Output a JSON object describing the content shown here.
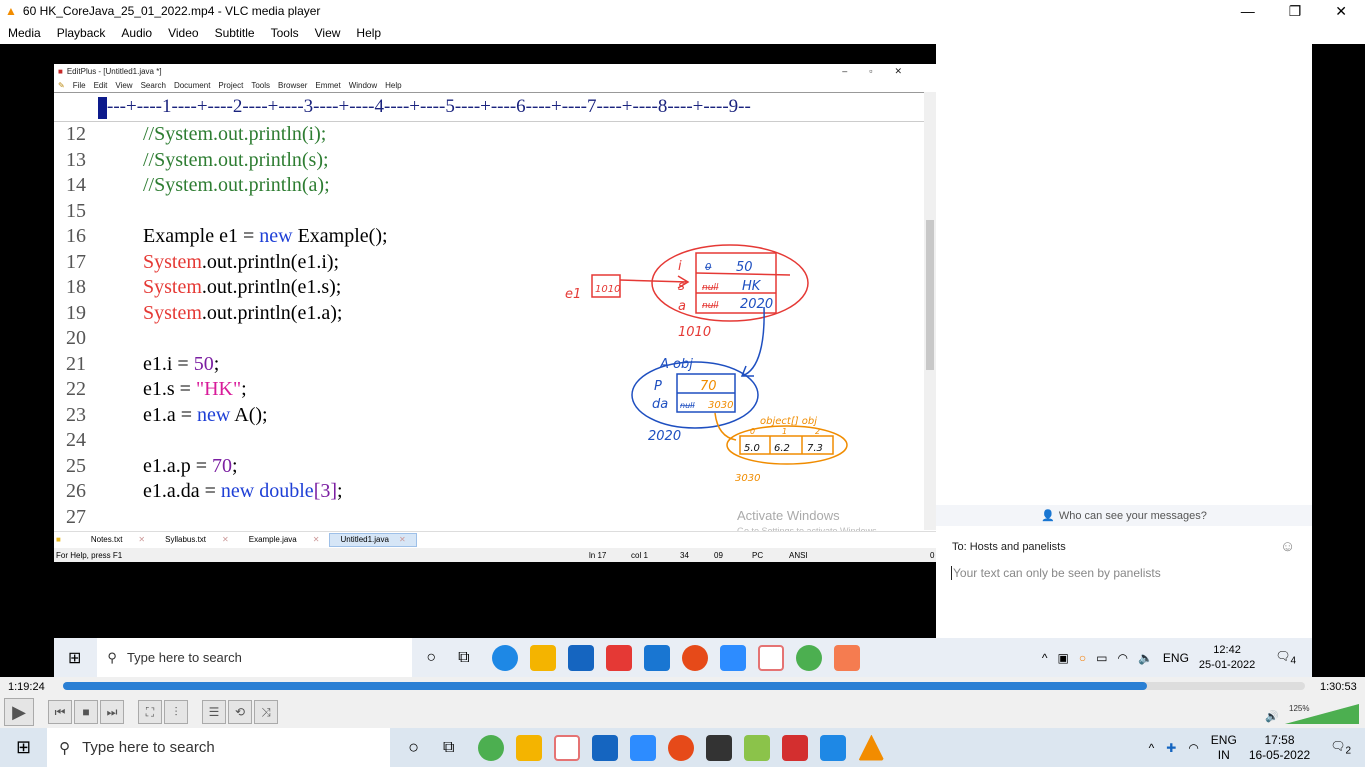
{
  "vlc": {
    "title": "60 HK_CoreJava_25_01_2022.mp4 - VLC media player",
    "menu": [
      "Media",
      "Playback",
      "Audio",
      "Video",
      "Subtitle",
      "Tools",
      "View",
      "Help"
    ],
    "time_elapsed": "1:19:24",
    "time_total": "1:30:53",
    "progress": 0.873,
    "volume": "125%"
  },
  "editplus": {
    "title": "EditPlus - [Untitled1.java *]",
    "menu": [
      "File",
      "Edit",
      "View",
      "Search",
      "Document",
      "Project",
      "Tools",
      "Browser",
      "Emmet",
      "Window",
      "Help"
    ],
    "ruler": "---+----1----+----2----+----3----+----4----+----5----+----6----+----7----+----8----+----9--",
    "lines": [
      {
        "n": "12",
        "parts": [
          [
            "cmt",
            "//System.out.println(i);"
          ]
        ]
      },
      {
        "n": "13",
        "parts": [
          [
            "cmt",
            "//System.out.println(s);"
          ]
        ]
      },
      {
        "n": "14",
        "parts": [
          [
            "cmt",
            "//System.out.println(a);"
          ]
        ]
      },
      {
        "n": "15",
        "parts": []
      },
      {
        "n": "16",
        "parts": [
          [
            "",
            "Example e1 = "
          ],
          [
            "kw",
            "new"
          ],
          [
            "",
            " Example();"
          ]
        ]
      },
      {
        "n": "17",
        "parts": [
          [
            "red",
            "System"
          ],
          [
            "",
            ".out.println(e1.i);"
          ]
        ]
      },
      {
        "n": "18",
        "parts": [
          [
            "red",
            "System"
          ],
          [
            "",
            ".out.println(e1.s);"
          ]
        ]
      },
      {
        "n": "19",
        "parts": [
          [
            "red",
            "System"
          ],
          [
            "",
            ".out.println(e1.a);"
          ]
        ]
      },
      {
        "n": "20",
        "parts": []
      },
      {
        "n": "21",
        "parts": [
          [
            "",
            "e1.i = "
          ],
          [
            "num",
            "50"
          ],
          [
            "",
            ";"
          ]
        ]
      },
      {
        "n": "22",
        "parts": [
          [
            "",
            "e1.s = "
          ],
          [
            "str",
            "\"HK\""
          ],
          [
            "",
            ";"
          ]
        ]
      },
      {
        "n": "23",
        "parts": [
          [
            "",
            "e1.a = "
          ],
          [
            "kw",
            "new"
          ],
          [
            "",
            " A();"
          ]
        ]
      },
      {
        "n": "24",
        "parts": []
      },
      {
        "n": "25",
        "parts": [
          [
            "",
            "e1.a.p = "
          ],
          [
            "num",
            "70"
          ],
          [
            "",
            ";"
          ]
        ]
      },
      {
        "n": "26",
        "parts": [
          [
            "",
            "e1.a.da = "
          ],
          [
            "kw",
            "new"
          ],
          [
            "",
            " "
          ],
          [
            "kw",
            "double"
          ],
          [
            "num",
            "[3]"
          ],
          [
            "",
            ";"
          ]
        ]
      },
      {
        "n": "27",
        "parts": []
      }
    ],
    "tabs": [
      "Notes.txt",
      "Syllabus.txt",
      "Example.java",
      "Untitled1.java"
    ],
    "status": {
      "help": "For Help, press F1",
      "ln": "ln 17",
      "col": "col 1",
      "a": "34",
      "b": "09",
      "mode": "PC",
      "enc": "ANSI",
      "last": "0"
    },
    "watermark": {
      "title": "Activate Windows",
      "sub": "Go to Settings to activate Windows."
    }
  },
  "diagram": {
    "e1": "e1",
    "ref": "1010",
    "fields1": [
      "i",
      "s",
      "a"
    ],
    "vals1": [
      "50",
      "HK",
      "2020"
    ],
    "old1": [
      "0",
      "null",
      "null"
    ],
    "addr1": "1010",
    "aobj": "A obj",
    "fields2": [
      "P",
      "da"
    ],
    "vals2": [
      "70",
      "3030"
    ],
    "old2": [
      "0",
      "null"
    ],
    "addr2": "2020",
    "arrlabel": "object[] obj",
    "arr": [
      "5.0",
      "6.2",
      "7.3"
    ],
    "idx": [
      "0",
      "1",
      "2"
    ],
    "addr3": "3030"
  },
  "chat": {
    "who": "Who can see your messages?",
    "to": "To:  Hosts and panelists",
    "placeholder": "Your text can only be seen by panelists"
  },
  "inner_taskbar": {
    "search": "Type here to search",
    "lang": "ENG",
    "time": "12:42",
    "date": "25-01-2022",
    "notif": "4"
  },
  "taskbar": {
    "search": "Type here to search",
    "lang": "ENG",
    "region": "IN",
    "time": "17:58",
    "date": "16-05-2022",
    "notif": "2"
  }
}
